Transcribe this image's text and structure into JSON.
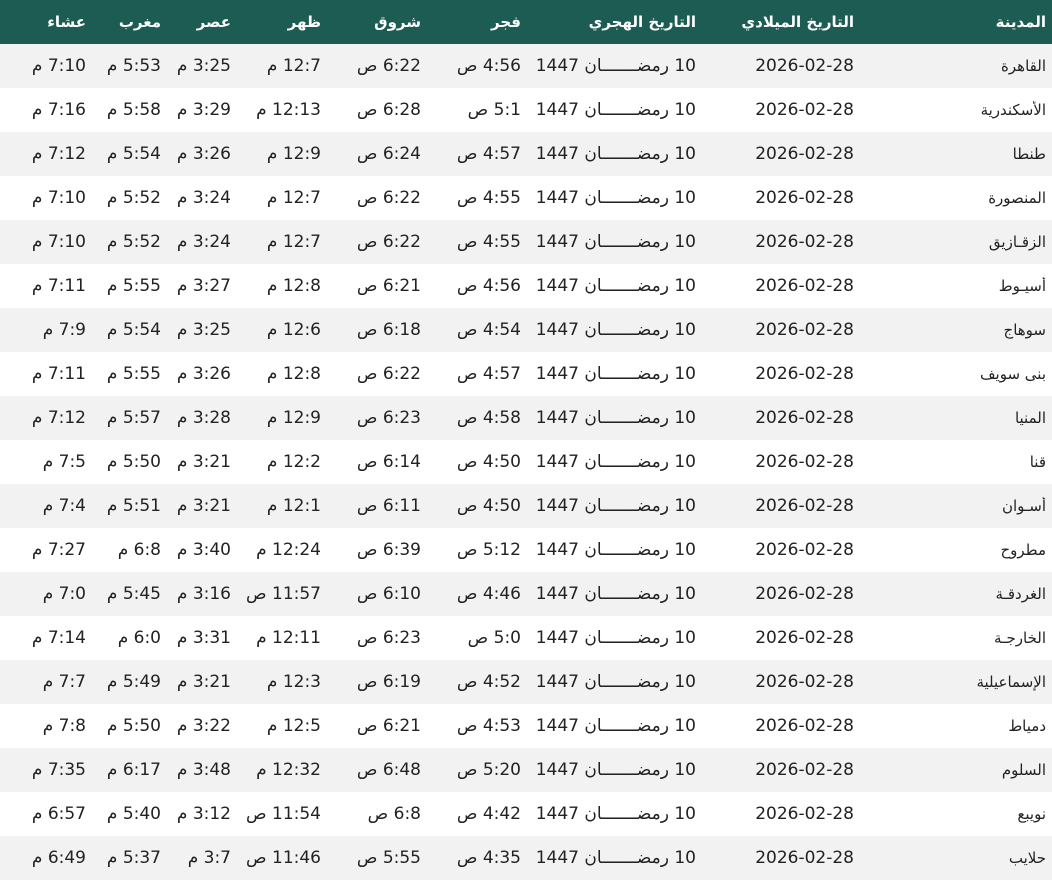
{
  "table": {
    "headers": {
      "city": "المدينة",
      "gregorian": "التاريخ الميلادي",
      "hijri": "التاريخ الهجري",
      "fajr": "فجر",
      "shuruq": "شروق",
      "dhuhr": "ظهر",
      "asr": "عصر",
      "maghrib": "مغرب",
      "isha": "عشاء"
    },
    "rows": [
      {
        "city": "القاهرة",
        "gregorian": "2026-02-28",
        "hijri": "10 رمضـــــــان 1447",
        "fajr": "4:56 ص",
        "shuruq": "6:22 ص",
        "dhuhr": "12:7 م",
        "asr": "3:25 م",
        "maghrib": "5:53 م",
        "isha": "7:10 م"
      },
      {
        "city": "الأسكندرية",
        "gregorian": "2026-02-28",
        "hijri": "10 رمضـــــــان 1447",
        "fajr": "5:1 ص",
        "shuruq": "6:28 ص",
        "dhuhr": "12:13 م",
        "asr": "3:29 م",
        "maghrib": "5:58 م",
        "isha": "7:16 م"
      },
      {
        "city": "طنطا",
        "gregorian": "2026-02-28",
        "hijri": "10 رمضـــــــان 1447",
        "fajr": "4:57 ص",
        "shuruq": "6:24 ص",
        "dhuhr": "12:9 م",
        "asr": "3:26 م",
        "maghrib": "5:54 م",
        "isha": "7:12 م"
      },
      {
        "city": "المنصورة",
        "gregorian": "2026-02-28",
        "hijri": "10 رمضـــــــان 1447",
        "fajr": "4:55 ص",
        "shuruq": "6:22 ص",
        "dhuhr": "12:7 م",
        "asr": "3:24 م",
        "maghrib": "5:52 م",
        "isha": "7:10 م"
      },
      {
        "city": "الزقـازيق",
        "gregorian": "2026-02-28",
        "hijri": "10 رمضـــــــان 1447",
        "fajr": "4:55 ص",
        "shuruq": "6:22 ص",
        "dhuhr": "12:7 م",
        "asr": "3:24 م",
        "maghrib": "5:52 م",
        "isha": "7:10 م"
      },
      {
        "city": "أسيـوط",
        "gregorian": "2026-02-28",
        "hijri": "10 رمضـــــــان 1447",
        "fajr": "4:56 ص",
        "shuruq": "6:21 ص",
        "dhuhr": "12:8 م",
        "asr": "3:27 م",
        "maghrib": "5:55 م",
        "isha": "7:11 م"
      },
      {
        "city": "سوهاج",
        "gregorian": "2026-02-28",
        "hijri": "10 رمضـــــــان 1447",
        "fajr": "4:54 ص",
        "shuruq": "6:18 ص",
        "dhuhr": "12:6 م",
        "asr": "3:25 م",
        "maghrib": "5:54 م",
        "isha": "7:9 م"
      },
      {
        "city": "بنى سويف",
        "gregorian": "2026-02-28",
        "hijri": "10 رمضـــــــان 1447",
        "fajr": "4:57 ص",
        "shuruq": "6:22 ص",
        "dhuhr": "12:8 م",
        "asr": "3:26 م",
        "maghrib": "5:55 م",
        "isha": "7:11 م"
      },
      {
        "city": "المنيا",
        "gregorian": "2026-02-28",
        "hijri": "10 رمضـــــــان 1447",
        "fajr": "4:58 ص",
        "shuruq": "6:23 ص",
        "dhuhr": "12:9 م",
        "asr": "3:28 م",
        "maghrib": "5:57 م",
        "isha": "7:12 م"
      },
      {
        "city": "قنا",
        "gregorian": "2026-02-28",
        "hijri": "10 رمضـــــــان 1447",
        "fajr": "4:50 ص",
        "shuruq": "6:14 ص",
        "dhuhr": "12:2 م",
        "asr": "3:21 م",
        "maghrib": "5:50 م",
        "isha": "7:5 م"
      },
      {
        "city": "أسـوان",
        "gregorian": "2026-02-28",
        "hijri": "10 رمضـــــــان 1447",
        "fajr": "4:50 ص",
        "shuruq": "6:11 ص",
        "dhuhr": "12:1 م",
        "asr": "3:21 م",
        "maghrib": "5:51 م",
        "isha": "7:4 م"
      },
      {
        "city": "مطروح",
        "gregorian": "2026-02-28",
        "hijri": "10 رمضـــــــان 1447",
        "fajr": "5:12 ص",
        "shuruq": "6:39 ص",
        "dhuhr": "12:24 م",
        "asr": "3:40 م",
        "maghrib": "6:8 م",
        "isha": "7:27 م"
      },
      {
        "city": "الغردقـة",
        "gregorian": "2026-02-28",
        "hijri": "10 رمضـــــــان 1447",
        "fajr": "4:46 ص",
        "shuruq": "6:10 ص",
        "dhuhr": "11:57 ص",
        "asr": "3:16 م",
        "maghrib": "5:45 م",
        "isha": "7:0 م"
      },
      {
        "city": "الخارجـة",
        "gregorian": "2026-02-28",
        "hijri": "10 رمضـــــــان 1447",
        "fajr": "5:0 ص",
        "shuruq": "6:23 ص",
        "dhuhr": "12:11 م",
        "asr": "3:31 م",
        "maghrib": "6:0 م",
        "isha": "7:14 م"
      },
      {
        "city": "الإسماعيلية",
        "gregorian": "2026-02-28",
        "hijri": "10 رمضـــــــان 1447",
        "fajr": "4:52 ص",
        "shuruq": "6:19 ص",
        "dhuhr": "12:3 م",
        "asr": "3:21 م",
        "maghrib": "5:49 م",
        "isha": "7:7 م"
      },
      {
        "city": "دمياط",
        "gregorian": "2026-02-28",
        "hijri": "10 رمضـــــــان 1447",
        "fajr": "4:53 ص",
        "shuruq": "6:21 ص",
        "dhuhr": "12:5 م",
        "asr": "3:22 م",
        "maghrib": "5:50 م",
        "isha": "7:8 م"
      },
      {
        "city": "السلوم",
        "gregorian": "2026-02-28",
        "hijri": "10 رمضـــــــان 1447",
        "fajr": "5:20 ص",
        "shuruq": "6:48 ص",
        "dhuhr": "12:32 م",
        "asr": "3:48 م",
        "maghrib": "6:17 م",
        "isha": "7:35 م"
      },
      {
        "city": "نويبع",
        "gregorian": "2026-02-28",
        "hijri": "10 رمضـــــــان 1447",
        "fajr": "4:42 ص",
        "shuruq": "6:8 ص",
        "dhuhr": "11:54 ص",
        "asr": "3:12 م",
        "maghrib": "5:40 م",
        "isha": "6:57 م"
      },
      {
        "city": "حلايب",
        "gregorian": "2026-02-28",
        "hijri": "10 رمضـــــــان 1447",
        "fajr": "4:35 ص",
        "shuruq": "5:55 ص",
        "dhuhr": "11:46 ص",
        "asr": "3:7 م",
        "maghrib": "5:37 م",
        "isha": "6:49 م"
      }
    ]
  },
  "colors": {
    "header_bg": "#1d5c52",
    "header_text": "#ffffff",
    "row_alt_bg": "#f2f2f2",
    "row_bg": "#ffffff",
    "text": "#222222"
  }
}
